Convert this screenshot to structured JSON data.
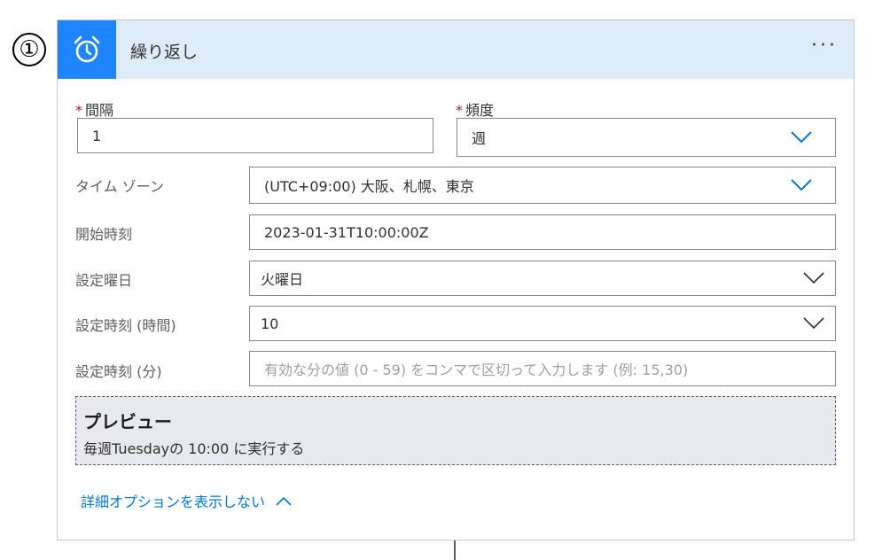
{
  "step_number": "①",
  "card": {
    "title": "繰り返し",
    "icon": "alarm-clock-icon",
    "more_label": "···",
    "accent_color": "#1f85ff",
    "header_bg": "#deecf9"
  },
  "fields": {
    "interval": {
      "required_mark": "*",
      "label": "間隔",
      "value": "1"
    },
    "frequency": {
      "required_mark": "*",
      "label": "頻度",
      "value": "週"
    },
    "timezone": {
      "label": "タイム ゾーン",
      "value": "(UTC+09:00) 大阪、札幌、東京"
    },
    "start_time": {
      "label": "開始時刻",
      "value": "2023-01-31T10:00:00Z"
    },
    "weekdays": {
      "label": "設定曜日",
      "value": "火曜日"
    },
    "hours": {
      "label": "設定時刻 (時間)",
      "value": "10"
    },
    "minutes": {
      "label": "設定時刻 (分)",
      "placeholder": "有効な分の値 (0 - 59) をコンマで区切って入力します (例: 15,30)"
    }
  },
  "preview": {
    "title": "プレビュー",
    "text": "毎週Tuesdayの 10:00 に実行する"
  },
  "advanced_toggle": {
    "label": "詳細オプションを表示しない",
    "icon": "chevron-up-icon"
  }
}
